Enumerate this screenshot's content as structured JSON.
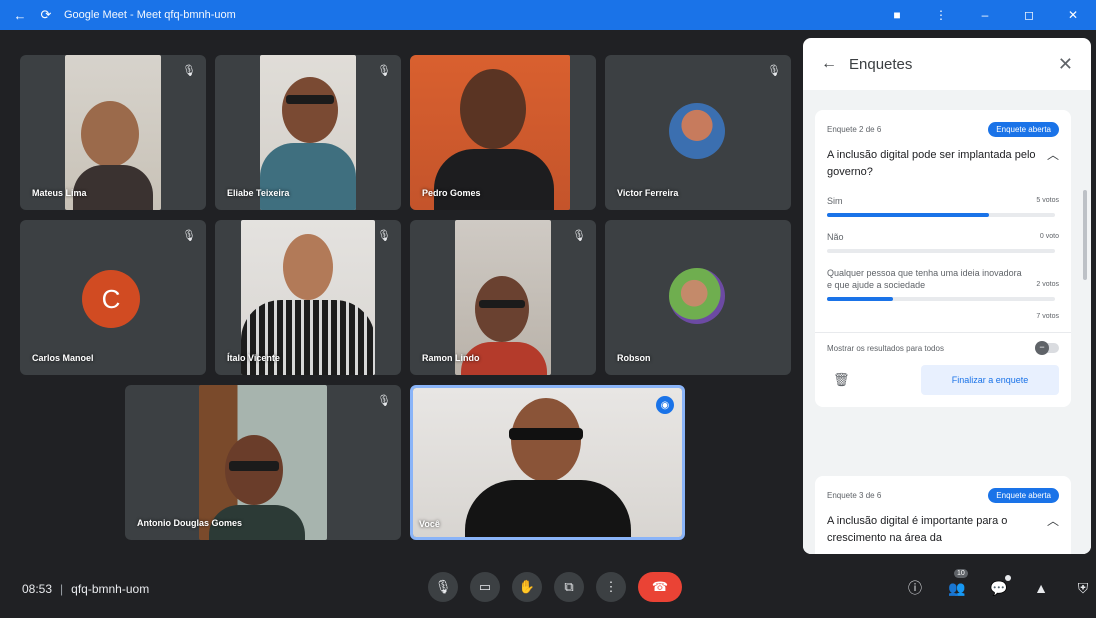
{
  "window": {
    "title": "Google Meet - Meet qfq-bmnh-uom"
  },
  "participants": [
    {
      "name": "Mateus Lima"
    },
    {
      "name": "Eliabe Teixeira"
    },
    {
      "name": "Pedro Gomes"
    },
    {
      "name": "Victor Ferreira"
    },
    {
      "name": "Carlos Manoel",
      "initial": "C"
    },
    {
      "name": "Ítalo Vicente"
    },
    {
      "name": "Ramon Lindo"
    },
    {
      "name": "Robson"
    },
    {
      "name": "Antonio Douglas Gomes"
    },
    {
      "name": "Você"
    }
  ],
  "bottom": {
    "time": "08:53",
    "separator": "|",
    "meeting_code": "qfq-bmnh-uom",
    "people_count": "10"
  },
  "panel": {
    "title": "Enquetes",
    "polls": [
      {
        "meta": "Enquete 2 de 6",
        "status": "Enquete aberta",
        "question": "A inclusão digital pode ser implantada pelo governo?",
        "options": [
          {
            "label": "Sim",
            "votes": "5 votos",
            "fraction": 0.71
          },
          {
            "label": "Não",
            "votes": "0 voto",
            "fraction": 0
          },
          {
            "label": "Qualquer pessoa que tenha uma ideia inovadora e que ajude a sociedade",
            "votes": "2 votos",
            "fraction": 0.29
          }
        ],
        "total": "7 votos",
        "show_results_label": "Mostrar os resultados para todos",
        "end_label": "Finalizar a enquete"
      },
      {
        "meta": "Enquete 3 de 6",
        "status": "Enquete aberta",
        "question": "A inclusão digital é importante para o crescimento na área da"
      }
    ]
  },
  "colors": {
    "titlebar": "#1a73e8",
    "accent": "#1a73e8",
    "hangup": "#ea4335",
    "stage_bg": "#202124",
    "tile_bg": "#3c4043"
  }
}
